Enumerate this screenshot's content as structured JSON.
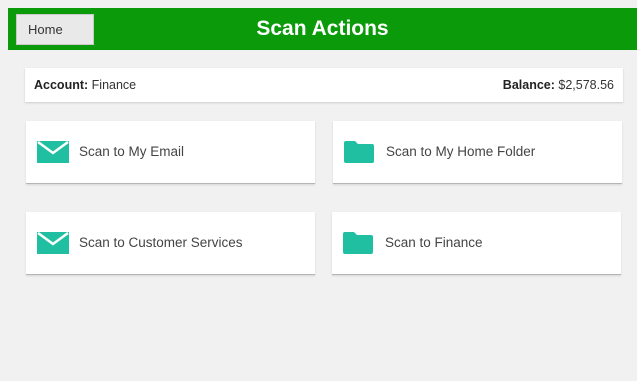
{
  "header": {
    "home_label": "Home",
    "title": "Scan Actions",
    "bg_color": "#0a9a0a"
  },
  "account": {
    "account_label": "Account:",
    "account_value": "Finance",
    "balance_label": "Balance:",
    "balance_value": "$2,578.56"
  },
  "tiles": [
    {
      "label": "Scan to My Email",
      "icon": "envelope-icon"
    },
    {
      "label": "Scan to My Home Folder",
      "icon": "folder-icon"
    },
    {
      "label": "Scan to Customer Services",
      "icon": "envelope-icon"
    },
    {
      "label": "Scan to Finance",
      "icon": "folder-icon"
    }
  ],
  "icon_color": "#21bfa2"
}
